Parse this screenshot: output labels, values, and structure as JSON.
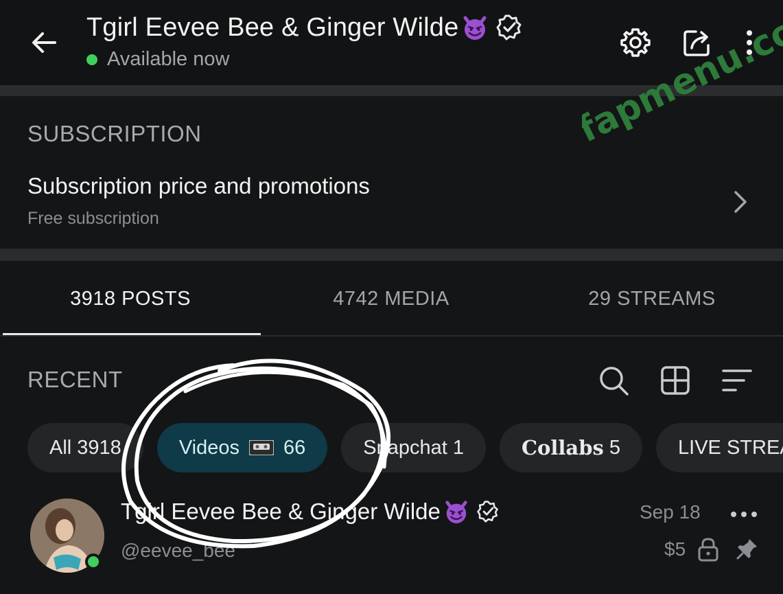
{
  "header": {
    "title": "Tgirl Eevee Bee & Ginger Wilde",
    "status": "Available now"
  },
  "subscription": {
    "heading": "SUBSCRIPTION",
    "title": "Subscription price and promotions",
    "subtitle": "Free subscription"
  },
  "tabs": [
    {
      "label": "3918 POSTS",
      "active": true
    },
    {
      "label": "4742 MEDIA",
      "active": false
    },
    {
      "label": "29 STREAMS",
      "active": false
    }
  ],
  "recent": {
    "label": "RECENT",
    "chips": [
      {
        "label": "All 3918"
      },
      {
        "label_before": "Videos",
        "label_after": "66"
      },
      {
        "label": "Snapchat 1"
      },
      {
        "label_bold": "Collabs",
        "count": "5"
      },
      {
        "label": "LIVE STREA"
      }
    ]
  },
  "post": {
    "name": "Tgirl Eevee Bee & Ginger Wilde",
    "handle": "@eevee_bee",
    "date": "Sep 18",
    "price": "$5"
  },
  "watermark": {
    "text": "fapmenu.com"
  },
  "colors": {
    "accent_chip": "#0f3a47",
    "online": "#3ecf5c",
    "watermark": "#2d7a3a"
  }
}
